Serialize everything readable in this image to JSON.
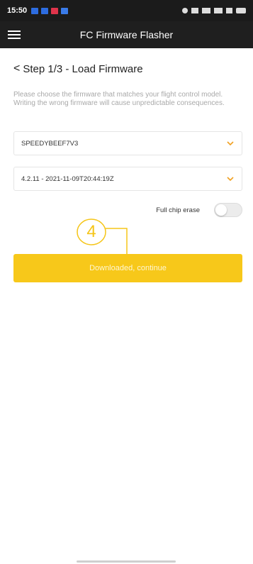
{
  "status_bar": {
    "time": "15:50",
    "notification_icons": [
      "app-icon-blue",
      "app-icon-blue",
      "app-icon-red",
      "app-icon-blue"
    ],
    "system_icons": [
      "settings-icon",
      "cast-icon",
      "signal-icon",
      "signal-icon",
      "wifi-icon",
      "battery-icon"
    ]
  },
  "app_bar": {
    "title": "FC Firmware Flasher",
    "menu_icon": "hamburger-menu-icon"
  },
  "step": {
    "title": "Step 1/3 - Load Firmware",
    "description": "Please choose the firmware that matches your flight control model. Writing the wrong firmware will cause unpredictable consequences."
  },
  "target_select": {
    "value": "SPEEDYBEEF7V3"
  },
  "version_select": {
    "value": "4.2.11 - 2021-11-09T20:44:19Z"
  },
  "full_chip_erase": {
    "label": "Full chip erase",
    "enabled": false
  },
  "annotation": {
    "number": "4"
  },
  "continue_button": {
    "label": "Downloaded, continue"
  },
  "colors": {
    "accent": "#f7c81a",
    "dropdown_arrow": "#f0a020",
    "annotation": "#f5c518",
    "appbar": "#1f1f1f"
  }
}
